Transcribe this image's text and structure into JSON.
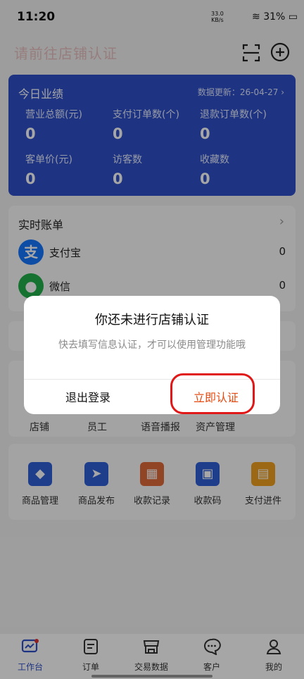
{
  "status": {
    "time": "11:20",
    "net_speed": "33.0",
    "net_unit": "KB/s",
    "battery": "31%"
  },
  "header": {
    "title": "请前往店铺认证",
    "scan_icon": "scan-icon",
    "add_icon": "plus-circle-icon"
  },
  "today": {
    "title": "今日业绩",
    "update": "数据更新：26-04-27",
    "metrics": [
      {
        "label": "营业总额(元)",
        "value": "0"
      },
      {
        "label": "支付订单数(个)",
        "value": "0"
      },
      {
        "label": "退款订单数(个)",
        "value": "0"
      },
      {
        "label": "客单价(元)",
        "value": "0"
      },
      {
        "label": "访客数",
        "value": "0"
      },
      {
        "label": "收藏数",
        "value": "0"
      }
    ]
  },
  "bill": {
    "title": "实时账单",
    "rows": [
      {
        "name": "支付宝",
        "amount": "0",
        "icon": "alipay-icon",
        "color": "#1677ff",
        "glyph": "支"
      },
      {
        "name": "微信",
        "amount": "0",
        "icon": "wechat-icon",
        "color": "#22b04a",
        "glyph": "●"
      }
    ]
  },
  "tools_row1": [
    {
      "label": "店铺"
    },
    {
      "label": "员工"
    },
    {
      "label": "语音播报"
    },
    {
      "label": "资产管理"
    }
  ],
  "tools_row2": [
    {
      "label": "商品管理",
      "icon": "tag-icon",
      "color": "#2e60d8",
      "glyph": "◆"
    },
    {
      "label": "商品发布",
      "icon": "send-icon",
      "color": "#2e60d8",
      "glyph": "➤"
    },
    {
      "label": "收款记录",
      "icon": "grid-icon",
      "color": "#e06a3a",
      "glyph": "▦"
    },
    {
      "label": "收款码",
      "icon": "qr-code-icon",
      "color": "#2e60d8",
      "glyph": "▣"
    },
    {
      "label": "支付进件",
      "icon": "briefcase-icon",
      "color": "#f0a020",
      "glyph": "▤"
    }
  ],
  "dialog": {
    "title": "你还未进行店铺认证",
    "message": "快去填写信息认证，才可以使用管理功能哦",
    "logout": "退出登录",
    "certify": "立即认证"
  },
  "nav": [
    {
      "label": "工作台",
      "icon": "workbench-icon",
      "glyph": "📈",
      "active": true
    },
    {
      "label": "订单",
      "icon": "order-icon",
      "glyph": "▭",
      "active": false
    },
    {
      "label": "交易数据",
      "icon": "store-icon",
      "glyph": "⌂",
      "active": false
    },
    {
      "label": "客户",
      "icon": "chat-icon",
      "glyph": "◌",
      "active": false
    },
    {
      "label": "我的",
      "icon": "user-icon",
      "glyph": "♙",
      "active": false
    }
  ]
}
